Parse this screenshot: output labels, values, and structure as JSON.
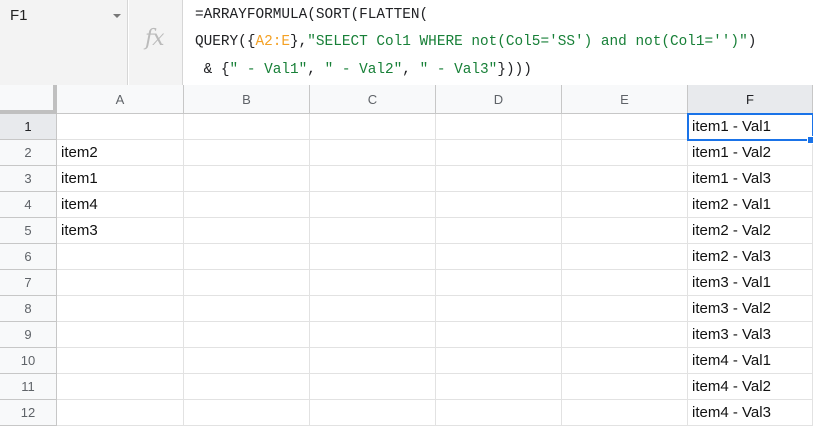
{
  "name_box": {
    "value": "F1"
  },
  "fx_label": "fx",
  "formula": {
    "line1": "=ARRAYFORMULA(SORT(FLATTEN(",
    "line2_pre": "QUERY({",
    "line2_ref": "A2:E",
    "line2_mid": "},",
    "line2_str": "\"SELECT Col1 WHERE not(Col5='SS') and not(Col1='')\"",
    "line2_post": ")",
    "line3_pre": " & {",
    "line3_s1": "\" - Val1\"",
    "line3_c1": ", ",
    "line3_s2": "\" - Val2\"",
    "line3_c2": ", ",
    "line3_s3": "\" - Val3\"",
    "line3_post": "})))"
  },
  "columns": [
    "A",
    "B",
    "C",
    "D",
    "E",
    "F"
  ],
  "rows": [
    "1",
    "2",
    "3",
    "4",
    "5",
    "6",
    "7",
    "8",
    "9",
    "10",
    "11",
    "12"
  ],
  "col_a": [
    "",
    "item2",
    "item1",
    "item4",
    "item3",
    "",
    "",
    "",
    "",
    "",
    "",
    ""
  ],
  "col_f": [
    "item1 - Val1",
    "item1 - Val2",
    "item1 - Val3",
    "item2 - Val1",
    "item2 - Val2",
    "item2 - Val3",
    "item3 - Val1",
    "item3 - Val2",
    "item3 - Val3",
    "item4 - Val1",
    "item4 - Val2",
    "item4 - Val3"
  ],
  "selected_cell": "F1"
}
